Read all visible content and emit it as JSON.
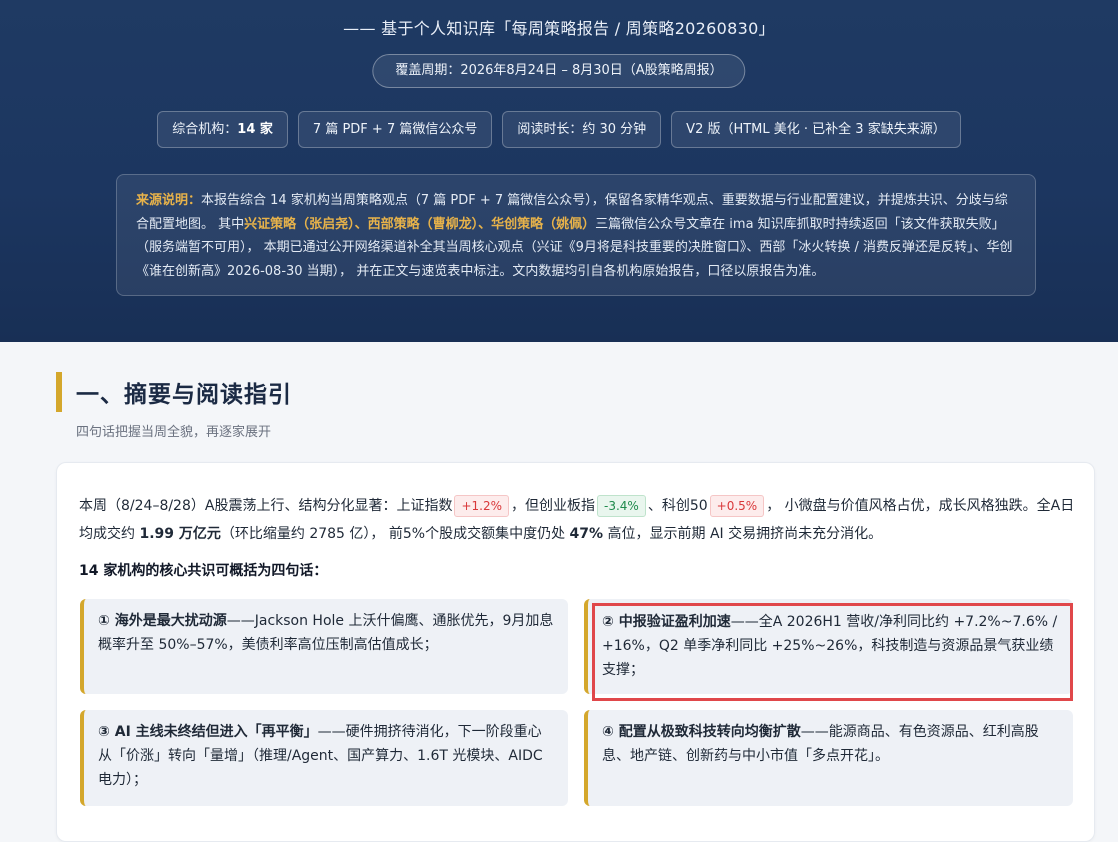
{
  "hero": {
    "subtitle": "—— 基于个人知识库「每周策略报告 / 周策略20260830」",
    "period": "覆盖周期：2026年8月24日 – 8月30日（A股策略周报）",
    "meta": {
      "institutions_prefix": "综合机构：",
      "institutions_count": "14 家",
      "sources": "7 篇 PDF + 7 篇微信公众号",
      "reading_time": "阅读时长：约 30 分钟",
      "version": "V2 版（HTML 美化 · 已补全 3 家缺失来源）"
    },
    "source_note": {
      "label": "来源说明：",
      "text_1": "本报告综合 14 家机构当周策略观点（7 篇 PDF + 7 篇微信公众号），保留各家精华观点、重要数据与行业配置建议，并提炼共识、分歧与综合配置地图。 其中",
      "highlight": "兴证策略（张启尧）、西部策略（曹柳龙）、华创策略（姚佩）",
      "text_2": "三篇微信公众号文章在 ima 知识库抓取时持续返回「该文件获取失败」（服务端暂不可用）， 本期已通过公开网络渠道补全其当周核心观点（兴证《9月将是科技重要的决胜窗口》、西部「冰火转换 / 消费反弹还是反转」、华创《谁在创新高》2026-08-30 当期）， 并在正文与速览表中标注。文内数据均引自各机构原始报告，口径以原报告为准。"
    }
  },
  "section": {
    "title": "一、摘要与阅读指引",
    "subtitle": "四句话把握当周全貌，再逐家展开"
  },
  "intro": {
    "t1": "本周（8/24–8/28）A股震荡上行、结构分化显著：上证指数",
    "sh_change": "+1.2%",
    "t2": "，但创业板指",
    "cyb_change": "-3.4%",
    "t3": "、科创50",
    "kc50_change": "+0.5%",
    "t4": "， 小微盘与价值风格占优，成长风格独跌。全A日均成交约",
    "turnover": "1.99 万亿元",
    "t5": "（环比缩量约 2785 亿）， 前5%个股成交额集中度仍处",
    "concentration": "47%",
    "t6": "高位，显示前期 AI 交易拥挤尚未充分消化。"
  },
  "lead": "14 家机构的核心共识可概括为四句话：",
  "points": [
    {
      "title": "① 海外是最大扰动源",
      "body": "——Jackson Hole 上沃什偏鹰、通胀优先，9月加息概率升至 50%–57%，美债利率高位压制高估值成长；"
    },
    {
      "title": "② 中报验证盈利加速",
      "body": "——全A 2026H1 营收/净利同比约 +7.2%~7.6% / +16%，Q2 单季净利同比 +25%~26%，科技制造与资源品景气获业绩支撑；"
    },
    {
      "title": "③ AI 主线未终结但进入「再平衡」",
      "body": "——硬件拥挤待消化，下一阶段重心从「价涨」转向「量增」（推理/Agent、国产算力、1.6T 光模块、AIDC 电力）；"
    },
    {
      "title": "④ 配置从极致科技转向均衡扩散",
      "body": "——能源商品、有色资源品、红利高股息、地产链、创新药与中小市值「多点开花」。"
    }
  ],
  "colors": {
    "hero_bg": "#1f3a63",
    "accent_gold": "#d4a72c",
    "up_red": "#d9383a",
    "down_green": "#1f8a4c",
    "highlight_box": "#e0474a"
  }
}
